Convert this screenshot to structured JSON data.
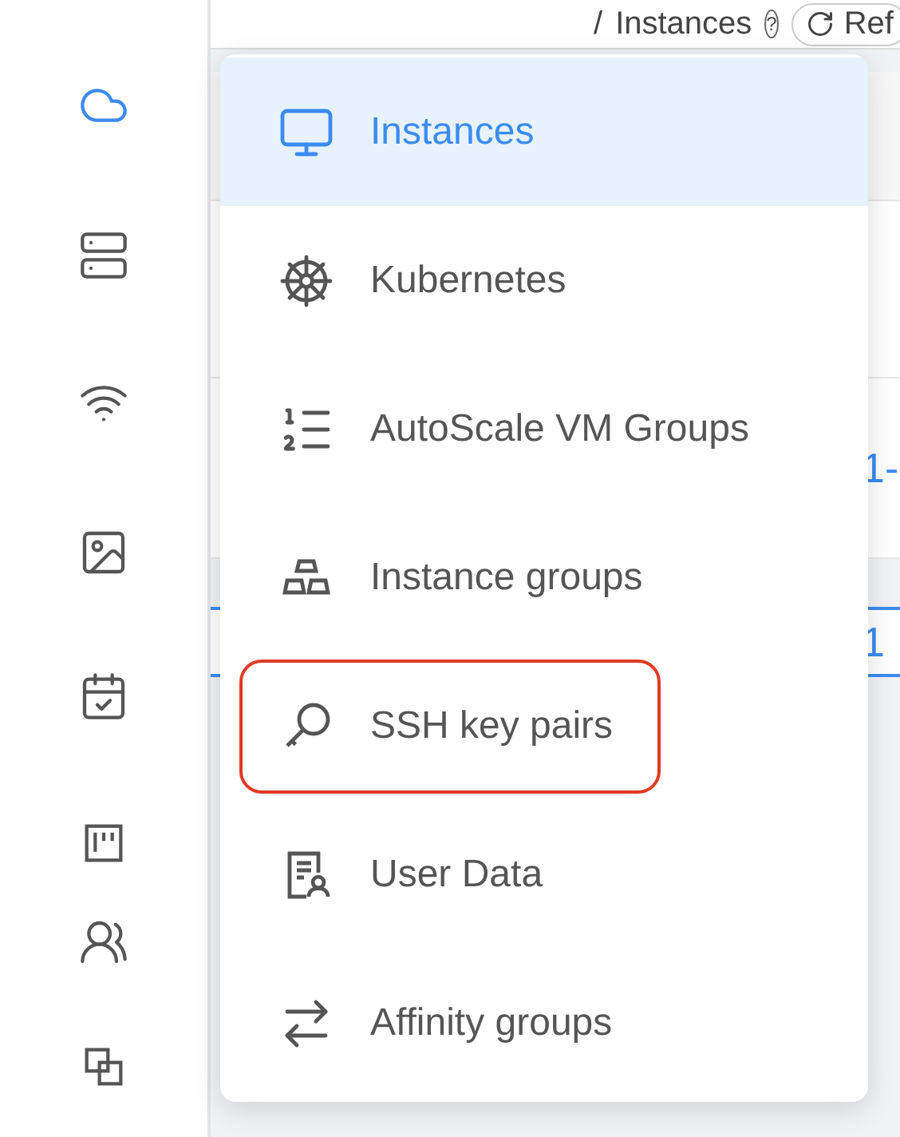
{
  "sidebar": {
    "items": [
      {
        "selected": true
      },
      {
        "selected": false
      },
      {
        "selected": false
      },
      {
        "selected": false
      },
      {
        "selected": false
      },
      {
        "selected": false
      },
      {
        "selected": false
      },
      {
        "selected": false
      }
    ]
  },
  "header": {
    "separator": "/",
    "title": "Instances",
    "help": "?",
    "refresh_button": "Ref"
  },
  "table": {
    "row_link": "1-",
    "pagination_current": "1"
  },
  "menu": {
    "items": [
      {
        "label": "Instances",
        "selected": true,
        "highlighted": false
      },
      {
        "label": "Kubernetes",
        "selected": false,
        "highlighted": false
      },
      {
        "label": "AutoScale VM Groups",
        "selected": false,
        "highlighted": false
      },
      {
        "label": "Instance groups",
        "selected": false,
        "highlighted": false
      },
      {
        "label": "SSH key pairs",
        "selected": false,
        "highlighted": true
      },
      {
        "label": "User Data",
        "selected": false,
        "highlighted": false
      },
      {
        "label": "Affinity groups",
        "selected": false,
        "highlighted": false
      }
    ]
  }
}
